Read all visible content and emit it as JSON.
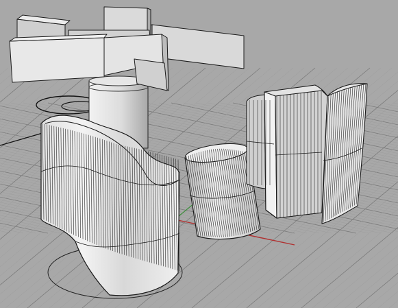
{
  "viewport": {
    "colors": {
      "background": "#a8a8a8",
      "grid_minor": "#9d9d9d",
      "grid_major": "#7a7a7a",
      "axis_x": "#b03030",
      "axis_y": "#3f8f3f",
      "surface_light": "#f0f0f0",
      "surface_mid": "#d8d8d8",
      "surface_shade": "#b8b8b8",
      "edge": "#1a1a1a"
    },
    "objects": [
      "cross-wall-roof",
      "central-column",
      "wavy-wall",
      "tilted-cylinder",
      "double-panel-wall"
    ]
  }
}
